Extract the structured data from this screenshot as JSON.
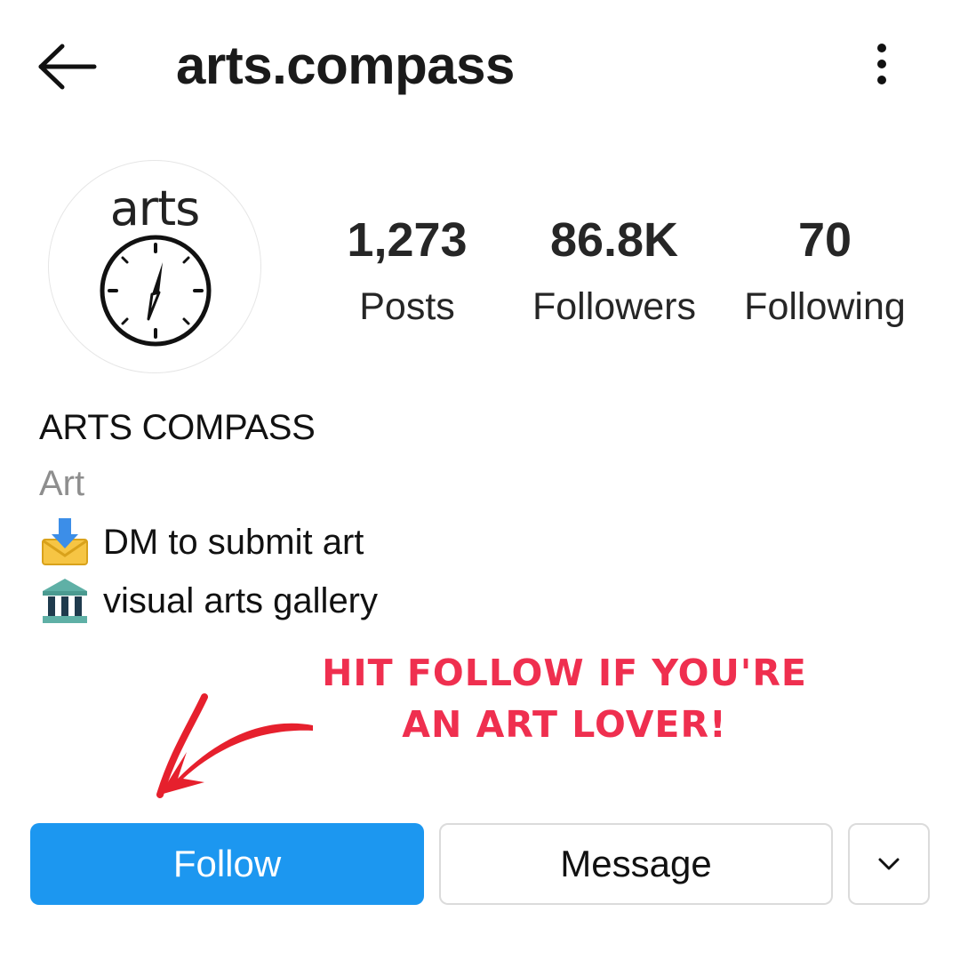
{
  "header": {
    "username": "arts.compass",
    "back_icon": "arrow-left-icon",
    "more_icon": "vertical-dots-icon"
  },
  "profile": {
    "avatar_text": "arts",
    "avatar_icon": "compass-icon",
    "stats": {
      "posts": {
        "value": "1,273",
        "label": "Posts"
      },
      "followers": {
        "value": "86.8K",
        "label": "Followers"
      },
      "following": {
        "value": "70",
        "label": "Following"
      }
    },
    "display_name": "ARTS COMPASS",
    "category": "Art",
    "bio": [
      {
        "icon": "inbox-tray-icon",
        "text": "DM to submit art"
      },
      {
        "icon": "classical-building-icon",
        "text": "visual arts gallery"
      }
    ]
  },
  "promo": {
    "line1": "HIT FOLLOW IF YOU'RE",
    "line2": "AN ART LOVER!",
    "color": "#ef2f4f"
  },
  "actions": {
    "follow_label": "Follow",
    "message_label": "Message",
    "dropdown_icon": "chevron-down-icon",
    "follow_color": "#1c97f0"
  }
}
